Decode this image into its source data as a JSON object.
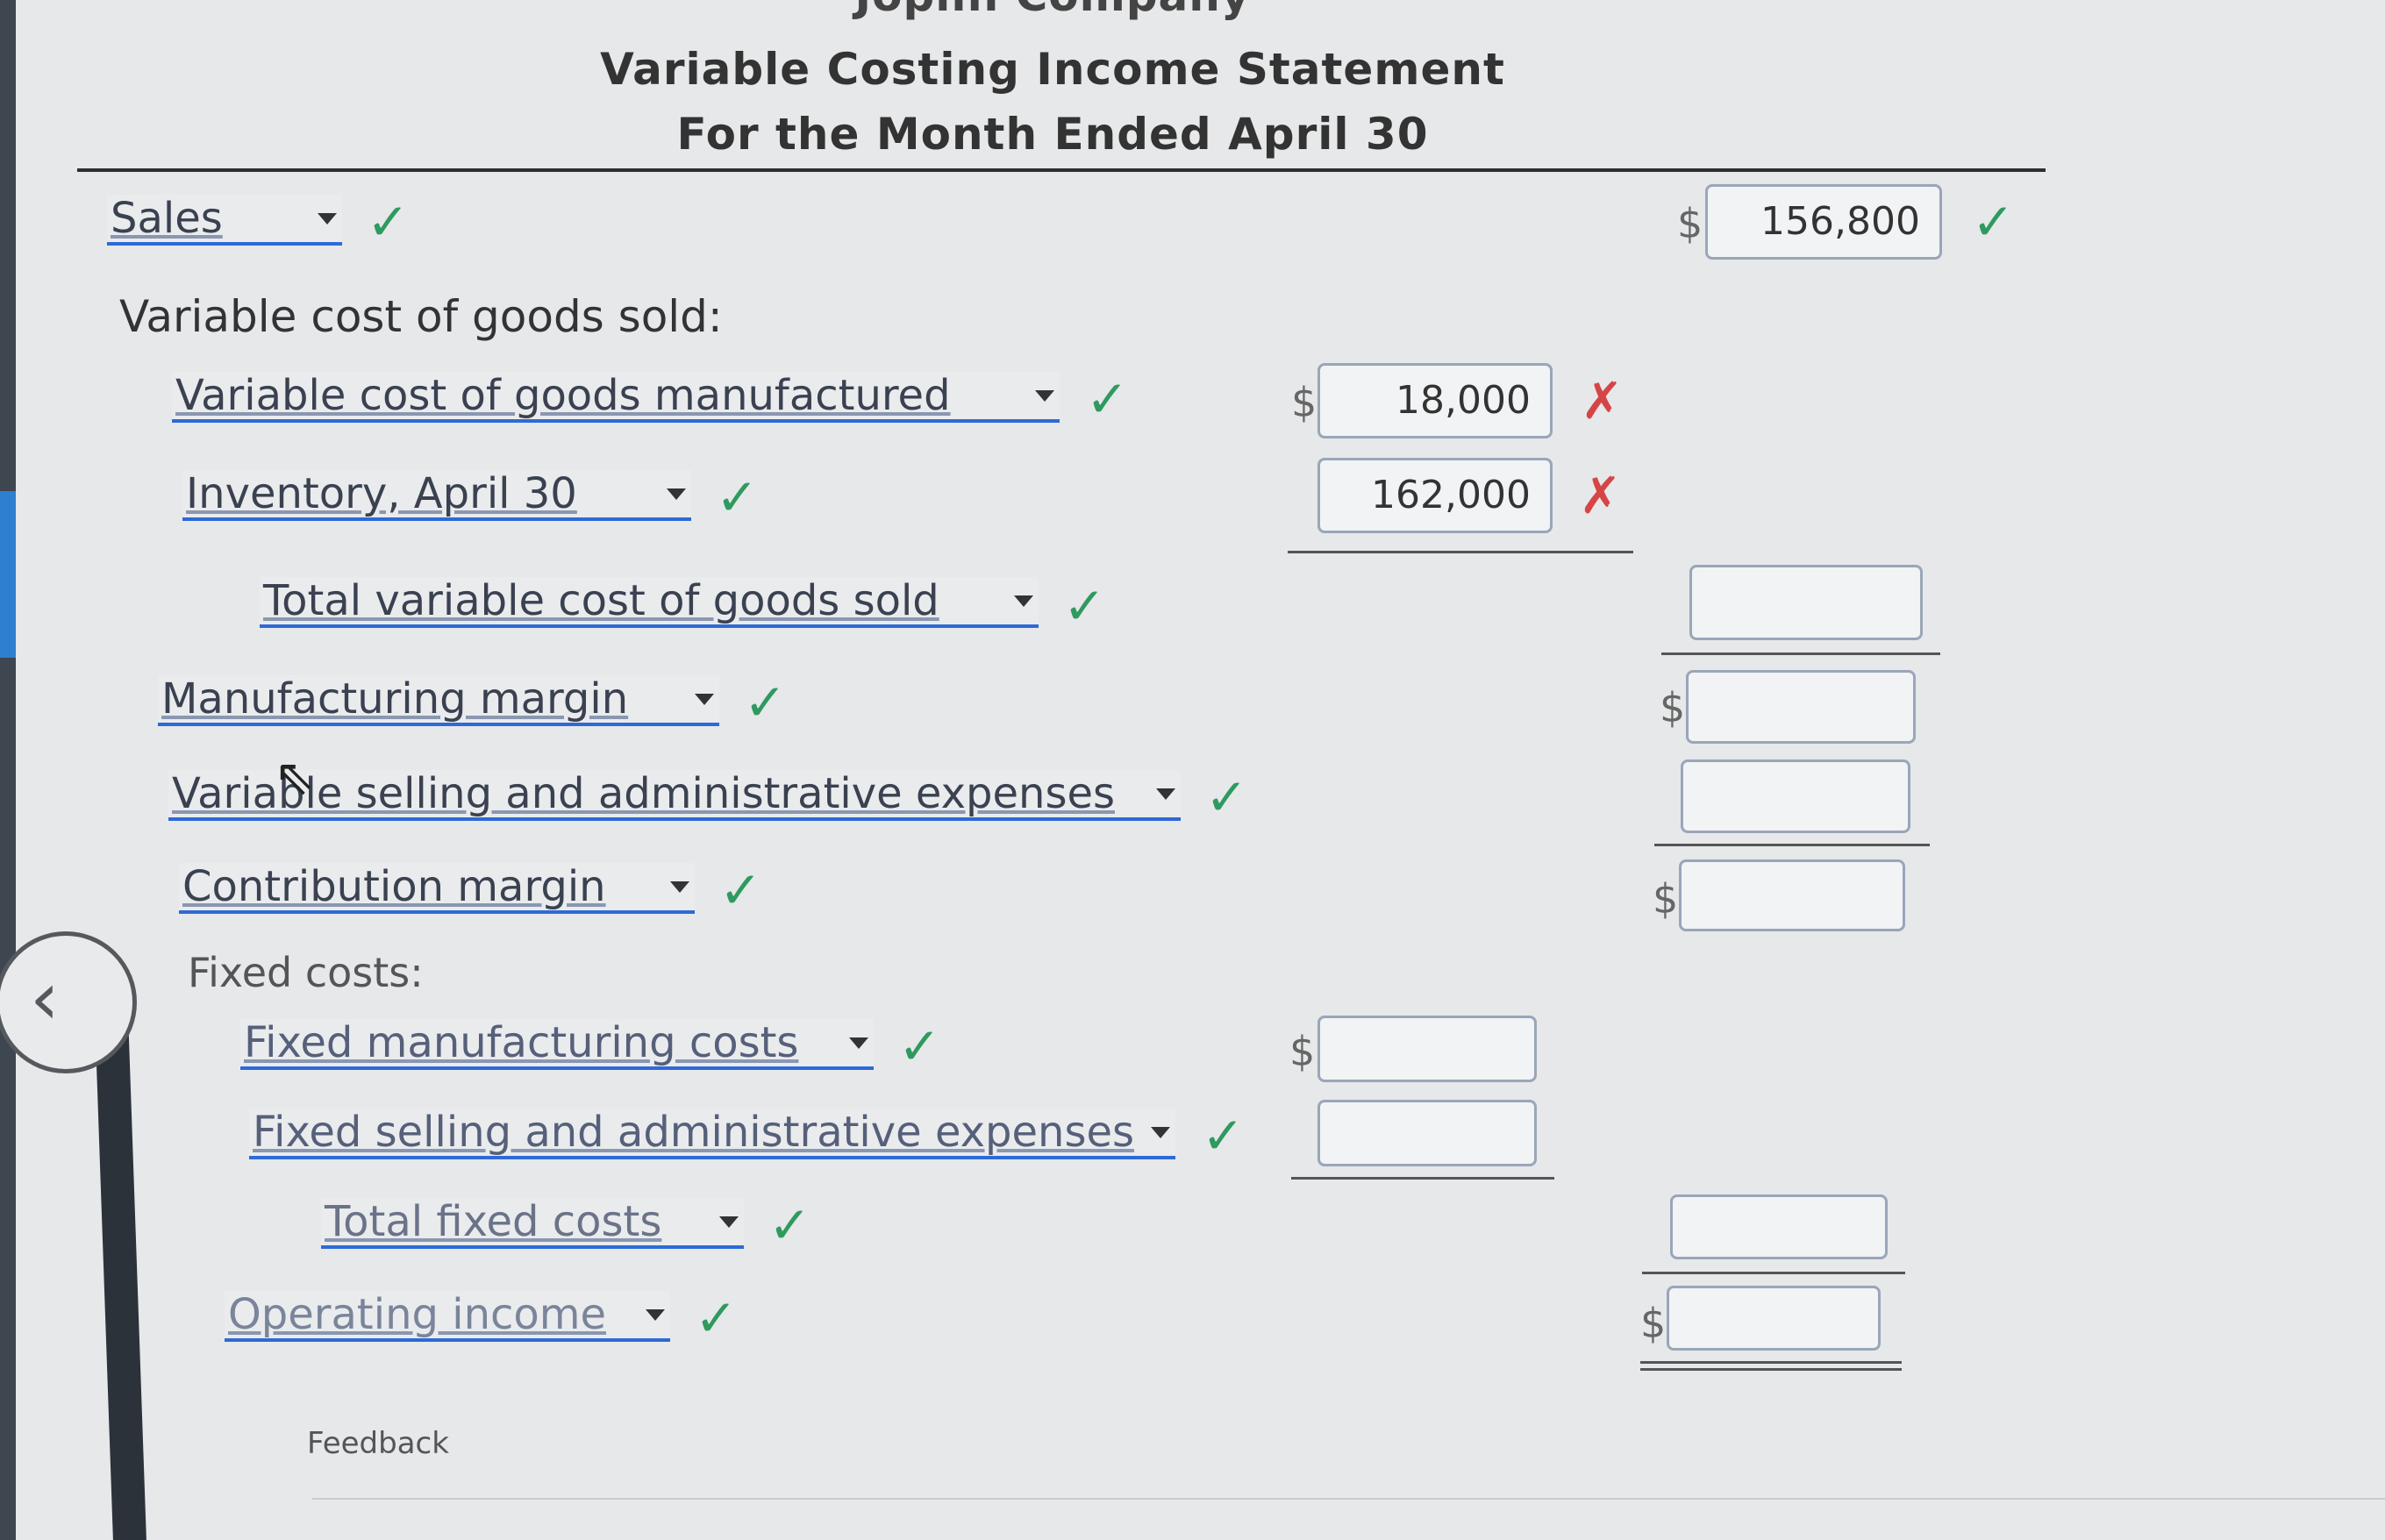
{
  "company_name": "Joplin Company",
  "statement_title": "Variable Costing Income Statement",
  "period": "For the Month Ended April 30",
  "icons": {
    "back": "chevron-left-icon",
    "correct": "check-icon",
    "incorrect": "x-icon"
  },
  "colors": {
    "check": "#2f9a5f",
    "x": "#d64545",
    "dropdown_underline": "#2e6ad6"
  },
  "symbols": {
    "check": "✓",
    "x": "✗",
    "dollar": "$",
    "back": "‹"
  },
  "rows": {
    "sales": {
      "label": "Sales",
      "amount": "156,800"
    },
    "vcogs_heading": "Variable cost of goods sold:",
    "vcogm": {
      "label": "Variable cost of goods manufactured",
      "amount": "18,000"
    },
    "inventory": {
      "label": "Inventory, April 30",
      "amount": "162,000"
    },
    "total_vcogs": {
      "label": "Total variable cost of goods sold",
      "amount": ""
    },
    "mfg_margin": {
      "label": "Manufacturing margin",
      "amount": ""
    },
    "var_sga": {
      "label": "Variable selling and administrative expenses",
      "amount": ""
    },
    "contrib_margin": {
      "label": "Contribution margin",
      "amount": ""
    },
    "fixed_heading": "Fixed costs:",
    "fixed_mfg": {
      "label": "Fixed manufacturing costs",
      "amount": ""
    },
    "fixed_sga": {
      "label": "Fixed selling and administrative expenses",
      "amount": ""
    },
    "total_fixed": {
      "label": "Total fixed costs",
      "amount": ""
    },
    "operating_income": {
      "label": "Operating income",
      "amount": ""
    }
  },
  "feedback_label": "Feedback"
}
